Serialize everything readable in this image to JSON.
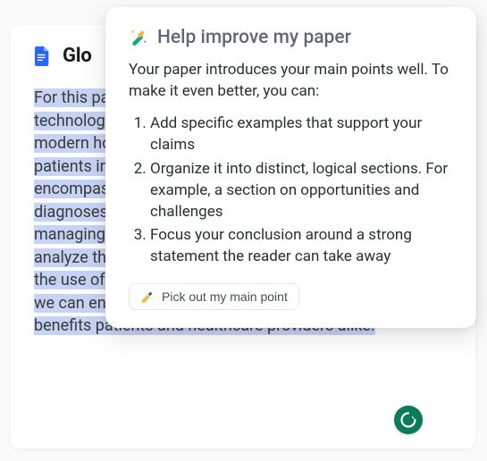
{
  "doc": {
    "title": "Glo",
    "body_text": "For this paper, I looked into a wide range of technology from different software programs in modern hospitals to automated scheduling for patients in hospitals. Technology in this area encompasses many processes, like getting diagnoses and medications out to the market, and managing costs in hospitals. This paper is going to analyze the opportunities and risks that arise from the use of technology in this field, and consider how we can ensure that technology is used in a way that benefits patients and healthcare providers alike."
  },
  "popup": {
    "title": "Help improve my paper",
    "intro": "Your paper introduces your main points well. To make it even better, you can:",
    "items": [
      "Add specific examples that support your claims",
      "Organize it into distinct, logical sections. For example, a section on opportunities and challenges",
      "Focus your conclusion around a strong statement the reader can take away"
    ],
    "chip_label": "Pick out my main point"
  },
  "colors": {
    "highlight": "#c7d3f5",
    "doc_icon": "#2b66f6",
    "grammarly": "#0b7a5a"
  }
}
